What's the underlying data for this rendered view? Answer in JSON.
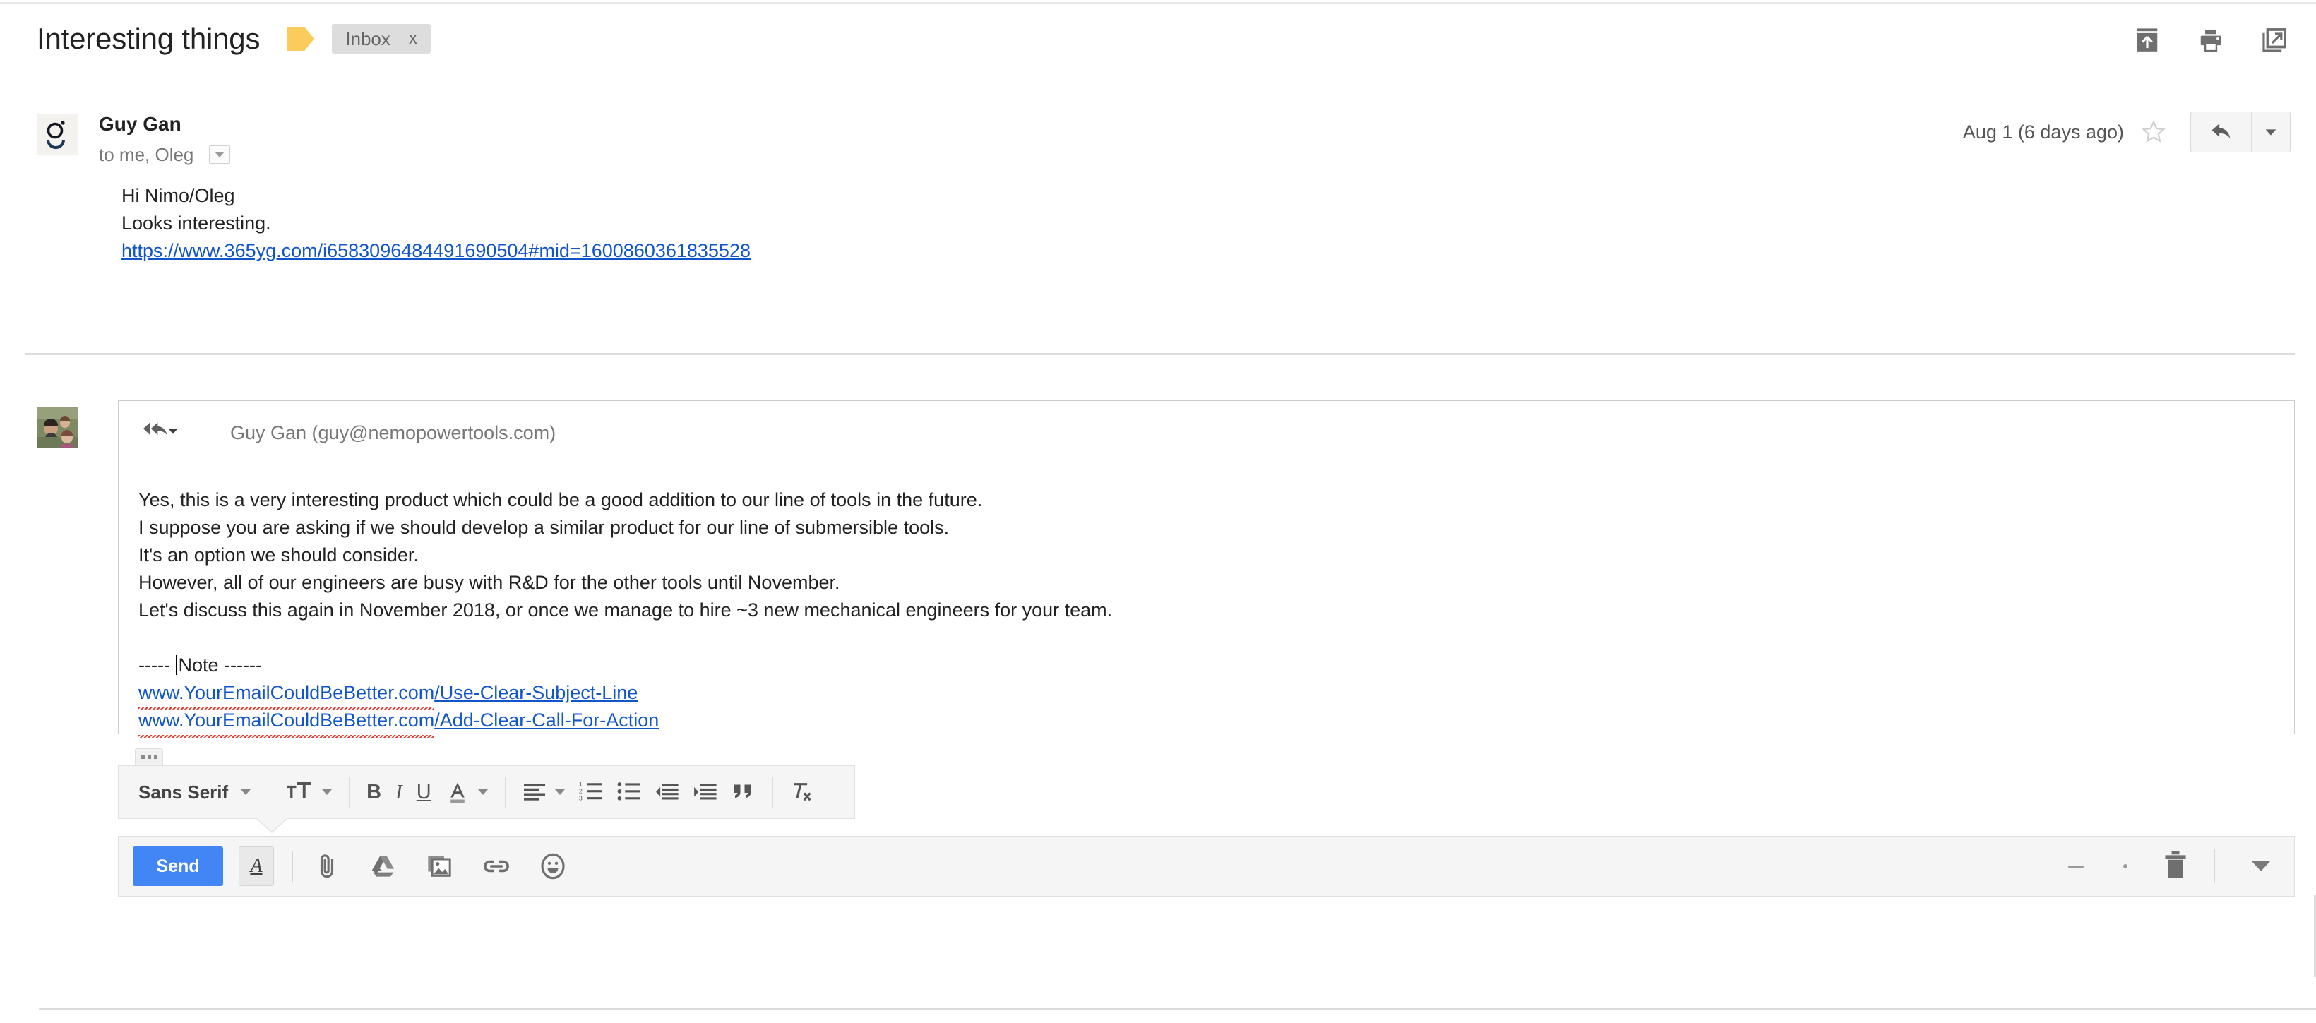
{
  "header": {
    "subject": "Interesting things",
    "label_icon": "label-tag-icon",
    "label_color": "#fbcc5c",
    "chip_label": "Inbox",
    "chip_close": "x",
    "actions": [
      {
        "name": "move-to-inbox-icon",
        "label": "Move to Inbox"
      },
      {
        "name": "print-icon",
        "label": "Print all"
      },
      {
        "name": "open-in-new-window-icon",
        "label": "Open in new window"
      }
    ]
  },
  "message": {
    "sender_name": "Guy Gan",
    "recipients": "to me, Oleg",
    "date": "Aug 1 (6 days ago)",
    "star_state": "unstarred",
    "body_lines": [
      "Hi Nimo/Oleg",
      "Looks interesting."
    ],
    "body_link": "https://www.365yg.com/i6583096484491690504#mid=1600860361835528"
  },
  "compose": {
    "reply_mode_icon": "reply-all-icon",
    "to_field": "Guy Gan (guy@nemopowertools.com)",
    "lines": [
      "Yes, this is a very interesting product which could be a good addition to our line of tools in the future.",
      "I suppose you are asking if we should develop a similar product for our line of submersible tools.",
      "It's an option we should consider.",
      "However, all of our engineers are busy with R&D for the other tools until November.",
      "Let's discuss this again in November 2018, or once we manage to hire ~3 new mechanical engineers for your team."
    ],
    "note_prefix": "----- ",
    "note_word": "Note ------",
    "link_one_base": "www.YourEmailCouldBeBetter.com",
    "link_one_path": "/Use-Clear-Subject-Line",
    "link_two_base": "www.YourEmailCouldBeBetter.com",
    "link_two_path": "/Add-Clear-Call-For-Action",
    "link_color": "#1155cc",
    "spellcheck_color": "#e33b2e"
  },
  "toolbar": {
    "more_options": "...",
    "font_family": "Sans Serif",
    "items": [
      {
        "name": "font-size-icon",
        "label": "Size"
      },
      {
        "name": "bold-button",
        "label": "B"
      },
      {
        "name": "italic-button",
        "label": "I"
      },
      {
        "name": "underline-button",
        "label": "U"
      },
      {
        "name": "text-color-button",
        "label": "A"
      },
      {
        "name": "align-button",
        "label": "Align"
      },
      {
        "name": "numbered-list-button",
        "label": "Numbered list"
      },
      {
        "name": "bulleted-list-button",
        "label": "Bulleted list"
      },
      {
        "name": "indent-less-button",
        "label": "Indent less"
      },
      {
        "name": "indent-more-button",
        "label": "Indent more"
      },
      {
        "name": "quote-button",
        "label": "Quote"
      },
      {
        "name": "remove-formatting-button",
        "label": "Remove formatting"
      }
    ]
  },
  "send_bar": {
    "send_label": "Send",
    "format_toggle_label": "A",
    "accent_color": "#4285f4",
    "icons": [
      {
        "name": "attach-file-icon",
        "label": "Attach files"
      },
      {
        "name": "google-drive-icon",
        "label": "Insert files using Drive"
      },
      {
        "name": "insert-photo-icon",
        "label": "Insert photo"
      },
      {
        "name": "insert-link-icon",
        "label": "Insert link"
      },
      {
        "name": "insert-emoji-icon",
        "label": "Insert emoji"
      }
    ],
    "right_icons": [
      {
        "name": "trash-icon",
        "label": "Discard draft"
      },
      {
        "name": "more-options-caret-icon",
        "label": "More options"
      }
    ]
  }
}
